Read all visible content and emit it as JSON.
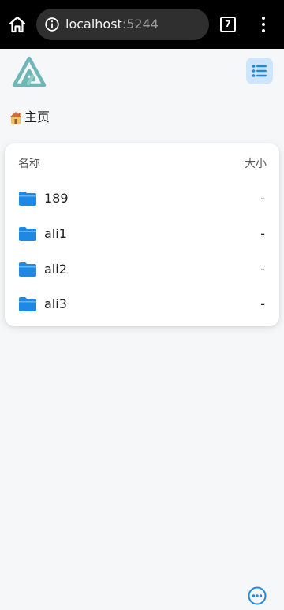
{
  "browser": {
    "url_host": "localhost",
    "url_port": ":5244",
    "tab_count": "7"
  },
  "breadcrumb": {
    "home_label": "主页"
  },
  "file_list": {
    "column_name": "名称",
    "column_size": "大小",
    "items": [
      {
        "name": "189",
        "size": "-"
      },
      {
        "name": "ali1",
        "size": "-"
      },
      {
        "name": "ali2",
        "size": "-"
      },
      {
        "name": "ali3",
        "size": "-"
      }
    ]
  },
  "icons": {
    "home": "home-icon",
    "info": "info-icon",
    "tabs": "tabs-icon",
    "menu": "more-vertical-icon",
    "logo": "app-logo",
    "list_toggle": "list-icon",
    "folder": "folder-icon",
    "more": "more-horizontal-icon"
  },
  "colors": {
    "accent": "#1e88e5",
    "logo": "#6fb7b7",
    "toggle_bg": "#cfe5fb"
  }
}
